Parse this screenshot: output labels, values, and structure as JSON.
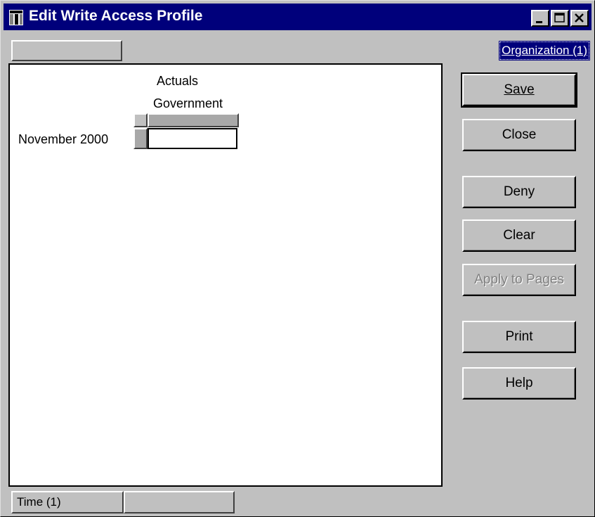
{
  "window": {
    "title": "Edit Write Access Profile"
  },
  "top_bar": {
    "organization_label": "Organization (1)"
  },
  "grid": {
    "column_header_1": "Actuals",
    "column_header_2": "Government",
    "row_label": "November 2000",
    "cell_value": ""
  },
  "buttons": {
    "save": "Save",
    "close": "Close",
    "deny": "Deny",
    "clear": "Clear",
    "apply_to_pages": "Apply to Pages",
    "print": "Print",
    "help": "Help"
  },
  "bottom_tabs": {
    "time_label": "Time (1)",
    "empty_label": ""
  }
}
